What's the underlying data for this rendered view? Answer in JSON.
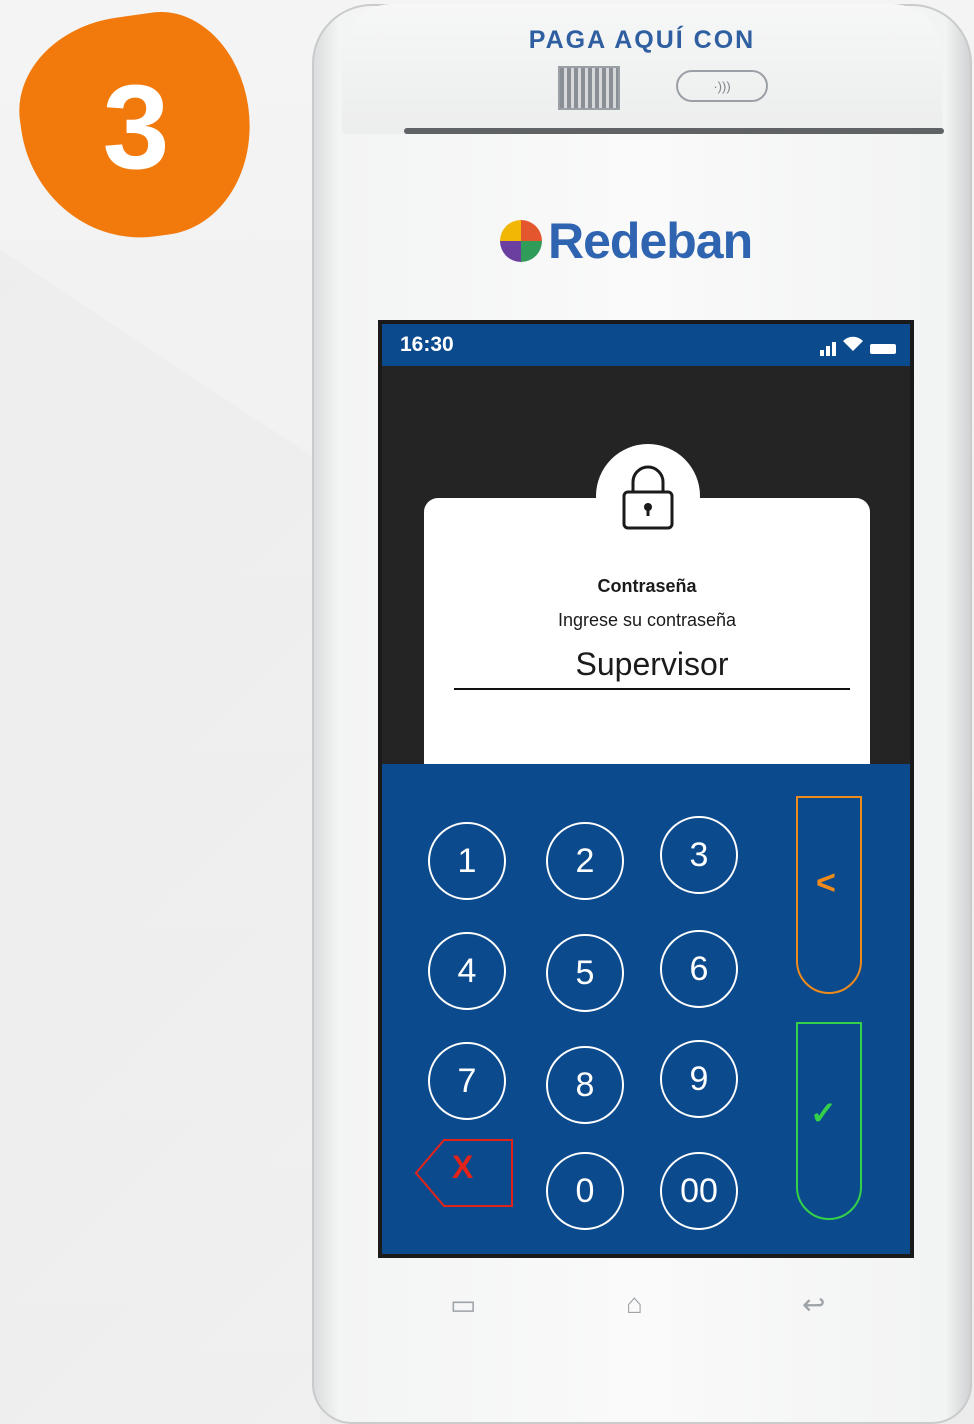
{
  "step": {
    "number": "3"
  },
  "device": {
    "printer_label": "PAGA AQUÍ CON",
    "nfc_label": "·)))",
    "brand": "Redeban"
  },
  "statusbar": {
    "time": "16:30"
  },
  "dialog": {
    "title": "Contraseña",
    "subtitle": "Ingrese su contraseña",
    "value": "Supervisor"
  },
  "keypad": {
    "keys": [
      "1",
      "2",
      "3",
      "4",
      "5",
      "6",
      "7",
      "8",
      "9",
      "0",
      "00"
    ],
    "delete_label": "X",
    "back_label": "<",
    "ok_label": "✓"
  },
  "colors": {
    "accent_orange": "#f27a0c",
    "keypad_blue": "#0b4a8c",
    "confirm_green": "#35d04a",
    "delete_red": "#e2231a"
  },
  "nav": {
    "recent": "▭",
    "home": "⌂",
    "back": "↩"
  }
}
